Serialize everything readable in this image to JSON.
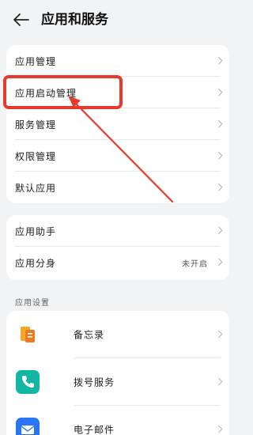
{
  "header": {
    "title": "应用和服务",
    "back_icon": "back-arrow-icon"
  },
  "group1": {
    "items": [
      {
        "label": "应用管理"
      },
      {
        "label": "应用启动管理"
      },
      {
        "label": "服务管理"
      },
      {
        "label": "权限管理"
      },
      {
        "label": "默认应用"
      }
    ]
  },
  "group2": {
    "items": [
      {
        "label": "应用助手"
      },
      {
        "label": "应用分身",
        "value": "未开启"
      }
    ]
  },
  "section_label": "应用设置",
  "apps": {
    "items": [
      {
        "label": "备忘录",
        "icon": "memo-icon"
      },
      {
        "label": "拨号服务",
        "icon": "dialer-icon"
      },
      {
        "label": "电子邮件",
        "icon": "email-icon"
      }
    ]
  },
  "colors": {
    "background": "#f1f3f5",
    "highlight": "#e8392d",
    "dialer": "#13b6a0",
    "email": "#2a74f6"
  }
}
